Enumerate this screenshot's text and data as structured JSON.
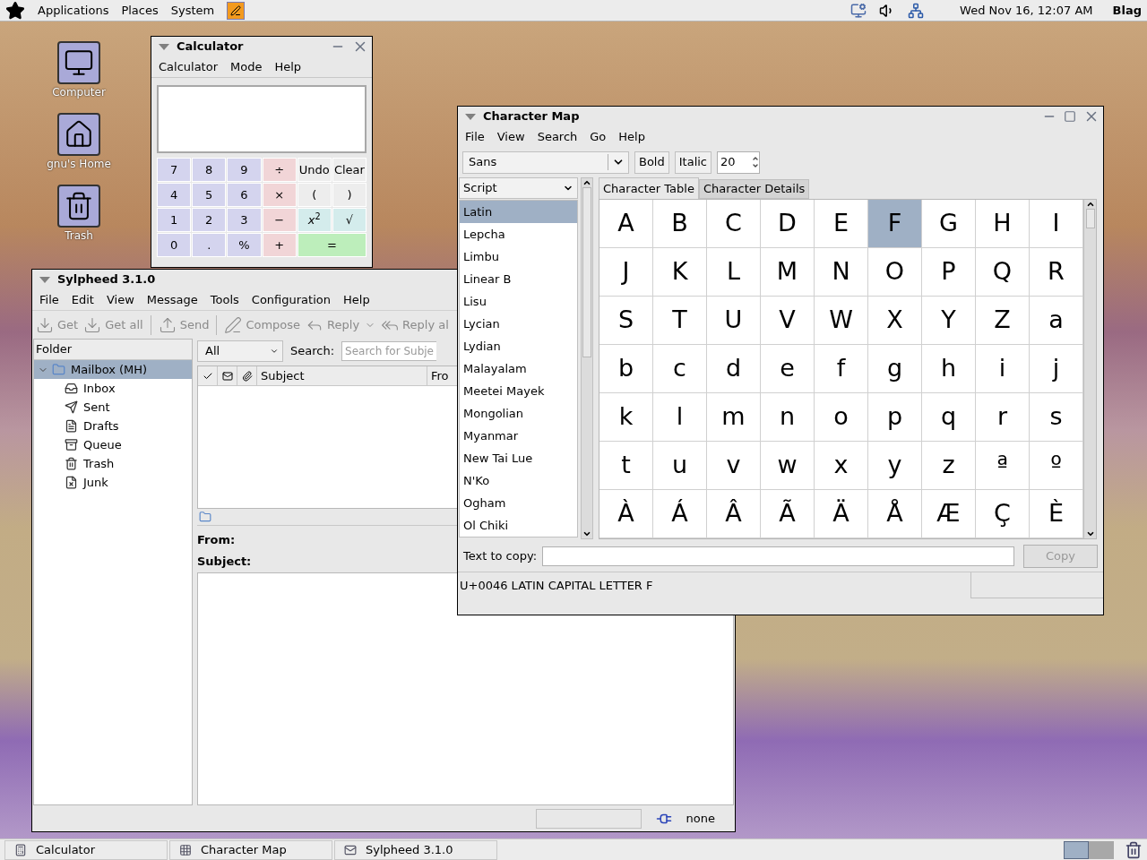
{
  "top_panel": {
    "menus": [
      "Applications",
      "Places",
      "System"
    ],
    "clock": "Wed Nov 16, 12:07 AM",
    "user": "Blag"
  },
  "desktop_icons": [
    {
      "label": "Computer",
      "kind": "computer"
    },
    {
      "label": "gnu's Home",
      "kind": "home"
    },
    {
      "label": "Trash",
      "kind": "trash"
    }
  ],
  "calculator": {
    "title": "Calculator",
    "menu": [
      "Calculator",
      "Mode",
      "Help"
    ],
    "buttons": [
      {
        "label": "7",
        "kind": "digit"
      },
      {
        "label": "8",
        "kind": "digit"
      },
      {
        "label": "9",
        "kind": "digit"
      },
      {
        "label": "÷",
        "kind": "operator"
      },
      {
        "label": "Undo",
        "kind": "function"
      },
      {
        "label": "Clear",
        "kind": "function"
      },
      {
        "label": "4",
        "kind": "digit"
      },
      {
        "label": "5",
        "kind": "digit"
      },
      {
        "label": "6",
        "kind": "digit"
      },
      {
        "label": "×",
        "kind": "operator"
      },
      {
        "label": "(",
        "kind": "function"
      },
      {
        "label": ")",
        "kind": "function"
      },
      {
        "label": "1",
        "kind": "digit"
      },
      {
        "label": "2",
        "kind": "digit"
      },
      {
        "label": "3",
        "kind": "digit"
      },
      {
        "label": "−",
        "kind": "operator"
      },
      {
        "label": "*x*$^{2}$",
        "kind": "math"
      },
      {
        "label": "√",
        "kind": "math"
      },
      {
        "label": "0",
        "kind": "digit"
      },
      {
        "label": ".",
        "kind": "digit"
      },
      {
        "label": "%",
        "kind": "digit"
      },
      {
        "label": "+",
        "kind": "operator"
      },
      {
        "label": "=",
        "kind": "equals"
      }
    ]
  },
  "sylpheed": {
    "title": "Sylpheed 3.1.0",
    "menu": [
      "File",
      "Edit",
      "View",
      "Message",
      "Tools",
      "Configuration",
      "Help"
    ],
    "toolbar": [
      {
        "label": "Get",
        "kind": "get",
        "disabled": true,
        "separator_before": false,
        "has_menu": false
      },
      {
        "label": "Get all",
        "kind": "get_all",
        "disabled": true,
        "separator_before": false,
        "has_menu": false
      },
      {
        "label": "Send",
        "kind": "send",
        "disabled": true,
        "separator_before": true,
        "has_menu": false
      },
      {
        "label": "Compose",
        "kind": "compose",
        "disabled": true,
        "separator_before": true,
        "has_menu": false
      },
      {
        "label": "Reply",
        "kind": "reply",
        "disabled": true,
        "separator_before": false,
        "has_menu": true
      },
      {
        "label": "Reply al",
        "kind": "reply_all",
        "disabled": true,
        "separator_before": false,
        "has_menu": false
      }
    ],
    "folder_header": "Folder",
    "folders": [
      {
        "label": "Mailbox (MH)",
        "kind": "mailbox",
        "expanded": true,
        "selected": true,
        "children": [
          {
            "label": "Inbox",
            "kind": "inbox",
            "selected": false
          },
          {
            "label": "Sent",
            "kind": "sent",
            "selected": false
          },
          {
            "label": "Drafts",
            "kind": "drafts",
            "selected": false
          },
          {
            "label": "Queue",
            "kind": "queue",
            "selected": false
          },
          {
            "label": "Trash",
            "kind": "trash",
            "selected": false
          },
          {
            "label": "Junk",
            "kind": "junk",
            "selected": false
          }
        ]
      }
    ],
    "filter": "All",
    "search_label": "Search:",
    "search_placeholder": "Search for Subje",
    "columns": [
      {
        "kind": "mark"
      },
      {
        "kind": "status"
      },
      {
        "kind": "attachment"
      },
      {
        "kind": "text",
        "label": "Subject"
      },
      {
        "kind": "text",
        "label": "Fro"
      }
    ],
    "header_labels": [
      "From:",
      "Subject:"
    ],
    "status": "none"
  },
  "charmap": {
    "title": "Character Map",
    "menu": [
      "File",
      "View",
      "Search",
      "Go",
      "Help"
    ],
    "font": "Sans",
    "bold_label": "Bold",
    "italic_label": "Italic",
    "size": "20",
    "script_selector": "Script",
    "scripts": [
      {
        "label": "Latin",
        "selected": true
      },
      {
        "label": "Lepcha",
        "selected": false
      },
      {
        "label": "Limbu",
        "selected": false
      },
      {
        "label": "Linear B",
        "selected": false
      },
      {
        "label": "Lisu",
        "selected": false
      },
      {
        "label": "Lycian",
        "selected": false
      },
      {
        "label": "Lydian",
        "selected": false
      },
      {
        "label": "Malayalam",
        "selected": false
      },
      {
        "label": "Meetei Mayek",
        "selected": false
      },
      {
        "label": "Mongolian",
        "selected": false
      },
      {
        "label": "Myanmar",
        "selected": false
      },
      {
        "label": "New Tai Lue",
        "selected": false
      },
      {
        "label": "N'Ko",
        "selected": false
      },
      {
        "label": "Ogham",
        "selected": false
      },
      {
        "label": "Ol Chiki",
        "selected": false
      }
    ],
    "tabs": [
      {
        "label": "Character Table",
        "selected": true
      },
      {
        "label": "Character Details",
        "selected": false
      }
    ],
    "character_rows": [
      [
        {
          "char": "A",
          "selected": false
        },
        {
          "char": "B",
          "selected": false
        },
        {
          "char": "C",
          "selected": false
        },
        {
          "char": "D",
          "selected": false
        },
        {
          "char": "E",
          "selected": false
        },
        {
          "char": "F",
          "selected": true
        },
        {
          "char": "G",
          "selected": false
        },
        {
          "char": "H",
          "selected": false
        },
        {
          "char": "I",
          "selected": false
        }
      ],
      [
        {
          "char": "J",
          "selected": false
        },
        {
          "char": "K",
          "selected": false
        },
        {
          "char": "L",
          "selected": false
        },
        {
          "char": "M",
          "selected": false
        },
        {
          "char": "N",
          "selected": false
        },
        {
          "char": "O",
          "selected": false
        },
        {
          "char": "P",
          "selected": false
        },
        {
          "char": "Q",
          "selected": false
        },
        {
          "char": "R",
          "selected": false
        }
      ],
      [
        {
          "char": "S",
          "selected": false
        },
        {
          "char": "T",
          "selected": false
        },
        {
          "char": "U",
          "selected": false
        },
        {
          "char": "V",
          "selected": false
        },
        {
          "char": "W",
          "selected": false
        },
        {
          "char": "X",
          "selected": false
        },
        {
          "char": "Y",
          "selected": false
        },
        {
          "char": "Z",
          "selected": false
        },
        {
          "char": "a",
          "selected": false
        }
      ],
      [
        {
          "char": "b",
          "selected": false
        },
        {
          "char": "c",
          "selected": false
        },
        {
          "char": "d",
          "selected": false
        },
        {
          "char": "e",
          "selected": false
        },
        {
          "char": "f",
          "selected": false
        },
        {
          "char": "g",
          "selected": false
        },
        {
          "char": "h",
          "selected": false
        },
        {
          "char": "i",
          "selected": false
        },
        {
          "char": "j",
          "selected": false
        }
      ],
      [
        {
          "char": "k",
          "selected": false
        },
        {
          "char": "l",
          "selected": false
        },
        {
          "char": "m",
          "selected": false
        },
        {
          "char": "n",
          "selected": false
        },
        {
          "char": "o",
          "selected": false
        },
        {
          "char": "p",
          "selected": false
        },
        {
          "char": "q",
          "selected": false
        },
        {
          "char": "r",
          "selected": false
        },
        {
          "char": "s",
          "selected": false
        }
      ],
      [
        {
          "char": "t",
          "selected": false
        },
        {
          "char": "u",
          "selected": false
        },
        {
          "char": "v",
          "selected": false
        },
        {
          "char": "w",
          "selected": false
        },
        {
          "char": "x",
          "selected": false
        },
        {
          "char": "y",
          "selected": false
        },
        {
          "char": "z",
          "selected": false
        },
        {
          "char": "ª",
          "selected": false
        },
        {
          "char": "º",
          "selected": false
        }
      ],
      [
        {
          "char": "À",
          "selected": false
        },
        {
          "char": "Á",
          "selected": false
        },
        {
          "char": "Â",
          "selected": false
        },
        {
          "char": "Ã",
          "selected": false
        },
        {
          "char": "Ä",
          "selected": false
        },
        {
          "char": "Å",
          "selected": false
        },
        {
          "char": "Æ",
          "selected": false
        },
        {
          "char": "Ç",
          "selected": false
        },
        {
          "char": "È",
          "selected": false
        }
      ]
    ],
    "text_to_copy_label": "Text to copy:",
    "copy": {
      "label": "Copy",
      "disabled": true
    },
    "status": "U+0046 LATIN CAPITAL LETTER F"
  },
  "taskbar": [
    {
      "label": "Calculator",
      "kind": "calculator"
    },
    {
      "label": "Character Map",
      "kind": "charmap"
    },
    {
      "label": "Sylpheed 3.1.0",
      "kind": "mail"
    }
  ]
}
